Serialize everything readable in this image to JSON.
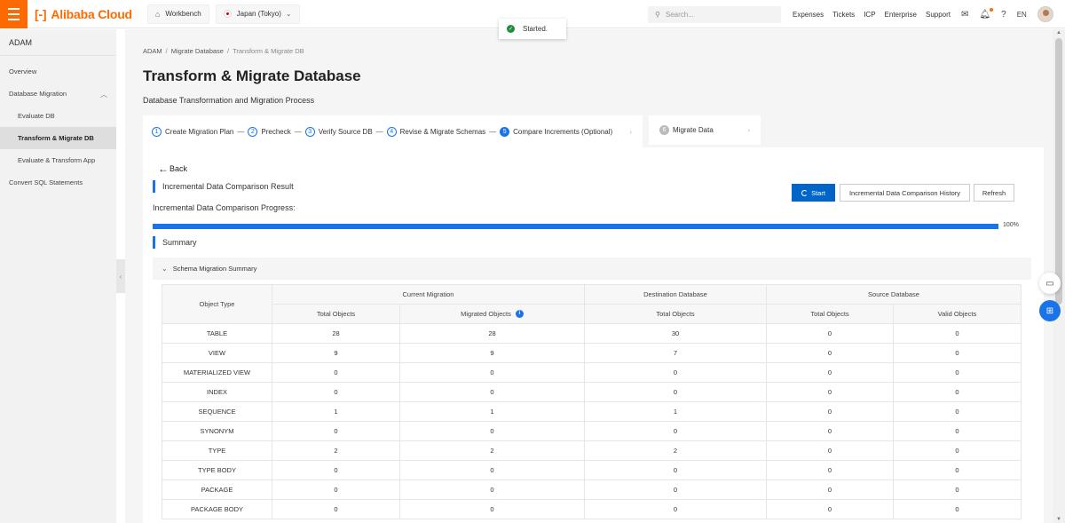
{
  "topbar": {
    "brand": "Alibaba Cloud",
    "brand_mark": "[-]",
    "workbench": "Workbench",
    "region": "Japan (Tokyo)",
    "search_placeholder": "Search...",
    "links": [
      "Expenses",
      "Tickets",
      "ICP",
      "Enterprise",
      "Support"
    ],
    "lang": "EN"
  },
  "toast": {
    "text": "Started."
  },
  "sidebar": {
    "title": "ADAM",
    "items": [
      {
        "label": "Overview"
      },
      {
        "label": "Database Migration"
      },
      {
        "label": "Evaluate DB"
      },
      {
        "label": "Transform & Migrate DB"
      },
      {
        "label": "Evaluate & Transform App"
      },
      {
        "label": "Convert SQL Statements"
      }
    ]
  },
  "breadcrumb": [
    "ADAM",
    "Migrate Database",
    "Transform & Migrate DB"
  ],
  "page": {
    "title": "Transform & Migrate Database",
    "subtitle": "Database Transformation and Migration Process"
  },
  "steps": [
    {
      "num": "1",
      "label": "Create Migration Plan"
    },
    {
      "num": "2",
      "label": "Precheck"
    },
    {
      "num": "3",
      "label": "Verify Source DB"
    },
    {
      "num": "4",
      "label": "Revise & Migrate Schemas"
    },
    {
      "num": "5",
      "label": "Compare Increments (Optional)"
    },
    {
      "num": "6",
      "label": "Migrate Data"
    }
  ],
  "panel": {
    "back": "Back",
    "section_result": "Incremental Data Comparison Result",
    "progress_label": "Incremental Data Comparison Progress:",
    "progress_value": 1.0,
    "progress_pct": "100%",
    "section_summary": "Summary",
    "btn_start": "Start",
    "btn_history": "Incremental Data Comparison History",
    "btn_refresh": "Refresh",
    "collapse_label": "Schema Migration Summary"
  },
  "table": {
    "group_headers": [
      "Object Type",
      "Current Migration",
      "Destination Database",
      "Source Database"
    ],
    "sub_headers": [
      "Total Objects",
      "Migrated Objects",
      "Total Objects",
      "Total Objects",
      "Valid Objects"
    ],
    "rows": [
      [
        "TABLE",
        "28",
        "28",
        "30",
        "0",
        "0"
      ],
      [
        "VIEW",
        "9",
        "9",
        "7",
        "0",
        "0"
      ],
      [
        "MATERIALIZED VIEW",
        "0",
        "0",
        "0",
        "0",
        "0"
      ],
      [
        "INDEX",
        "0",
        "0",
        "0",
        "0",
        "0"
      ],
      [
        "SEQUENCE",
        "1",
        "1",
        "1",
        "0",
        "0"
      ],
      [
        "SYNONYM",
        "0",
        "0",
        "0",
        "0",
        "0"
      ],
      [
        "TYPE",
        "2",
        "2",
        "2",
        "0",
        "0"
      ],
      [
        "TYPE BODY",
        "0",
        "0",
        "0",
        "0",
        "0"
      ],
      [
        "PACKAGE",
        "0",
        "0",
        "0",
        "0",
        "0"
      ],
      [
        "PACKAGE BODY",
        "0",
        "0",
        "0",
        "0",
        "0"
      ]
    ]
  },
  "colors": {
    "accent": "#1b73e8",
    "brand": "#ff6a00",
    "primary_button": "#0064c8"
  }
}
